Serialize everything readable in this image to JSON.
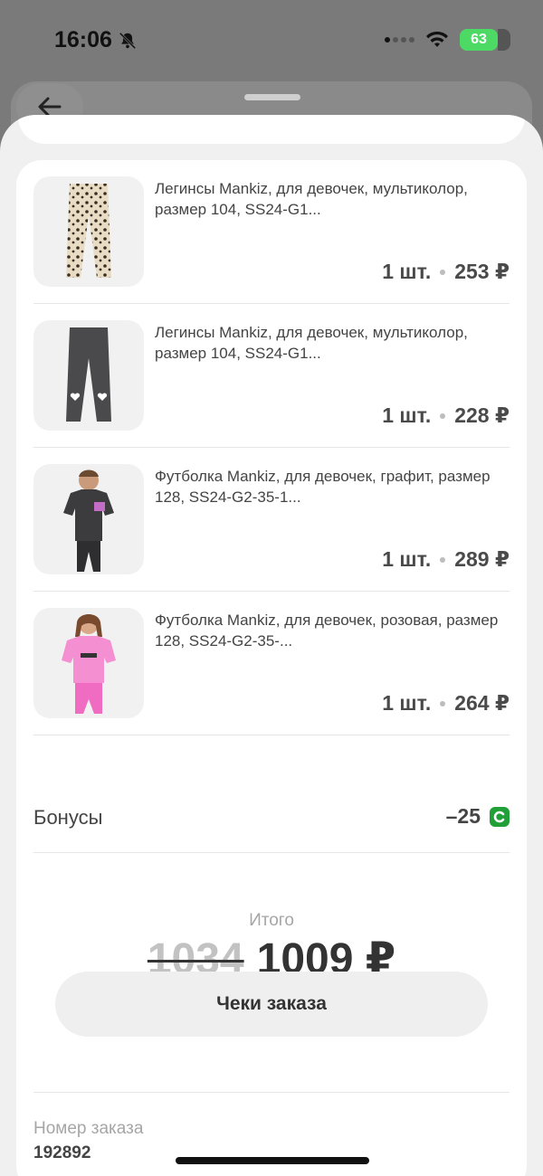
{
  "status_bar": {
    "time": "16:06",
    "battery": "63"
  },
  "items": [
    {
      "title": "Легинсы Mankiz, для девочек, мультиколор, размер 104, SS24-G1...",
      "quantity": "1 шт.",
      "price": "253 ₽",
      "image": "leopard-leggings-icon"
    },
    {
      "title": "Легинсы Mankiz, для девочек, мультиколор, размер 104, SS24-G1...",
      "quantity": "1 шт.",
      "price": "228 ₽",
      "image": "grey-leggings-icon"
    },
    {
      "title": "Футболка Mankiz, для девочек, графит, размер 128, SS24-G2-35-1...",
      "quantity": "1 шт.",
      "price": "289 ₽",
      "image": "graphite-tshirt-icon"
    },
    {
      "title": "Футболка Mankiz, для девочек, розовая, размер 128, SS24-G2-35-...",
      "quantity": "1 шт.",
      "price": "264 ₽",
      "image": "pink-tshirt-icon"
    }
  ],
  "bonuses": {
    "label": "Бонусы",
    "value": "–25"
  },
  "total": {
    "label": "Итого",
    "old_price": "1034",
    "new_price": "1009 ₽"
  },
  "receipts_button": "Чеки заказа",
  "order": {
    "label": "Номер заказа",
    "number": "192892"
  },
  "colors": {
    "bonus_badge": "#21a038",
    "battery": "#4cd964"
  }
}
